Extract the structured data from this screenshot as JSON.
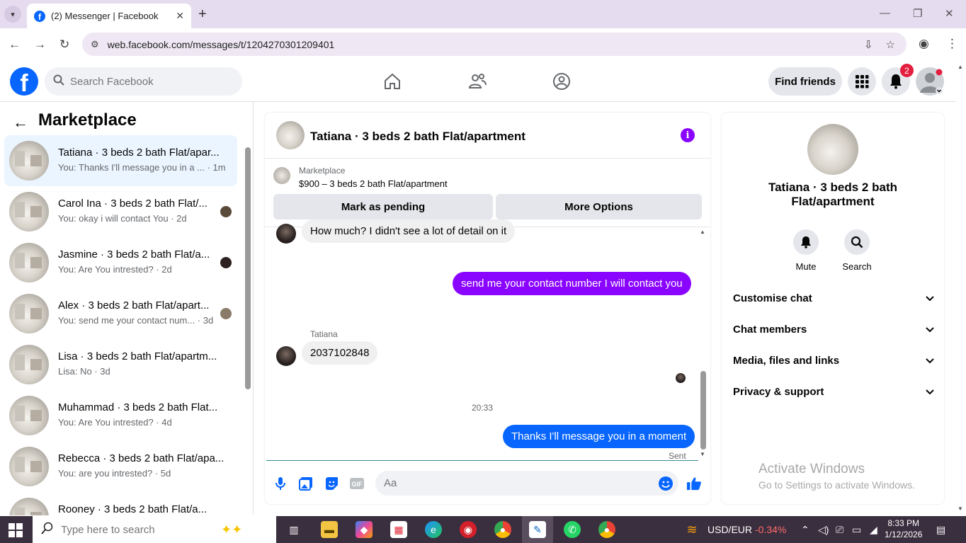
{
  "browser": {
    "tab_title": "(2) Messenger | Facebook",
    "url": "web.facebook.com/messages/t/1204270301209401"
  },
  "header": {
    "search_placeholder": "Search Facebook",
    "find_friends": "Find friends",
    "notification_count": "2"
  },
  "sidebar": {
    "title": "Marketplace",
    "conversations": [
      {
        "name": "Tatiana · 3 beds 2 bath Flat/apar...",
        "snippet": "You: Thanks I'll message you in a ...  · 1m"
      },
      {
        "name": "Carol Ina · 3 beds 2 bath Flat/...",
        "snippet": "You: okay i will contact You · 2d"
      },
      {
        "name": "Jasmine · 3 beds 2 bath Flat/a...",
        "snippet": "You: Are You intrested? · 2d"
      },
      {
        "name": "Alex · 3 beds 2 bath Flat/apart...",
        "snippet": "You: send me your contact num...  · 3d"
      },
      {
        "name": "Lisa · 3 beds 2 bath Flat/apartm...",
        "snippet": "Lisa: No · 3d"
      },
      {
        "name": "Muhammad · 3 beds 2 bath Flat...",
        "snippet": "You: Are You intrested? · 4d"
      },
      {
        "name": "Rebecca · 3 beds 2 bath Flat/apa...",
        "snippet": "You: are you intrested? · 5d"
      },
      {
        "name": "Rooney · 3 beds 2 bath Flat/a...",
        "snippet": ""
      }
    ]
  },
  "chat": {
    "title": "Tatiana · 3 beds 2 bath Flat/apartment",
    "marketplace_label": "Marketplace",
    "listing": "$900 – 3 beds 2 bath Flat/apartment",
    "mark_pending": "Mark as pending",
    "more_options": "More Options",
    "messages": {
      "m1": "How much? I didn't see a lot of detail on it",
      "m2": "send me your contact number I will contact you",
      "sender": "Tatiana",
      "m3": "2037102848",
      "time": "20:33",
      "m4": "Thanks I'll message you in a moment",
      "status": "Sent"
    },
    "composer_placeholder": "Aa"
  },
  "details": {
    "name": "Tatiana · 3 beds 2 bath Flat/apartment",
    "mute": "Mute",
    "search": "Search",
    "rows": [
      "Customise chat",
      "Chat members",
      "Media, files and links",
      "Privacy & support"
    ]
  },
  "watermark": {
    "line1": "Activate Windows",
    "line2": "Go to Settings to activate Windows."
  },
  "taskbar": {
    "search_placeholder": "Type here to search",
    "currency": "USD/EUR",
    "change": "-0.34%",
    "time": "8:33 PM",
    "date": "1/12/2026"
  },
  "colors": {
    "facebook_blue": "#0866ff",
    "messenger_purple": "#8a05ff",
    "negative": "#ff6b6b"
  }
}
